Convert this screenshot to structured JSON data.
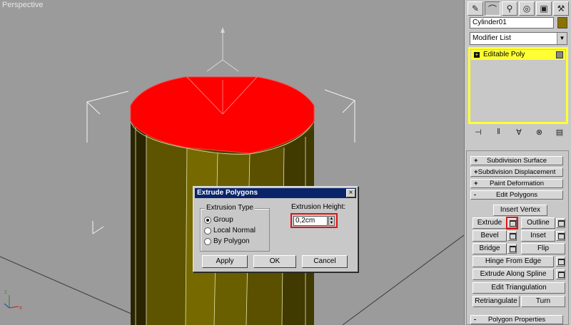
{
  "viewport": {
    "label": "Perspective"
  },
  "panel": {
    "tabs": [
      "create-icon",
      "modify-icon",
      "hierarchy-icon",
      "motion-icon",
      "display-icon",
      "utilities-icon"
    ],
    "object_name": "Cylinder01",
    "object_color": "#8a7200",
    "modifier_list": "Modifier List",
    "stack_item": "Editable Poly",
    "rollouts": {
      "subdivision_surface": "Subdivision Surface",
      "subdivision_displacement": "Subdivision Displacement",
      "paint_deformation": "Paint Deformation",
      "edit_polygons": "Edit Polygons",
      "polygon_properties": "Polygon Properties"
    },
    "signs": {
      "collapsed": "+",
      "expanded": "-"
    },
    "buttons": {
      "insert_vertex": "Insert Vertex",
      "extrude": "Extrude",
      "outline": "Outline",
      "bevel": "Bevel",
      "inset": "Inset",
      "bridge": "Bridge",
      "flip": "Flip",
      "hinge_from_edge": "Hinge From Edge",
      "extrude_along_spline": "Extrude Along Spline",
      "edit_triangulation": "Edit Triangulation",
      "retriangulate": "Retriangulate",
      "turn": "Turn"
    }
  },
  "dialog": {
    "title": "Extrude Polygons",
    "close": "×",
    "group_label": "Extrusion Type",
    "options": [
      "Group",
      "Local Normal",
      "By Polygon"
    ],
    "selected_option": "Group",
    "height_label": "Extrusion Height:",
    "height_value": "0,2cm",
    "apply": "Apply",
    "ok": "OK",
    "cancel": "Cancel"
  },
  "colors": {
    "selection_red": "#ff0000",
    "highlight_yellow": "#ffff33",
    "title_blue": "#0a246a"
  }
}
